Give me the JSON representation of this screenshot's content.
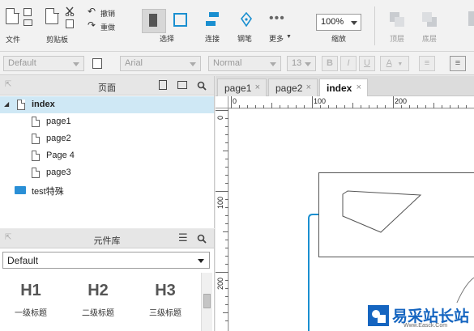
{
  "toolbar": {
    "file_label": "文件",
    "clipboard_label": "剪贴板",
    "undo_label": "撤销",
    "redo_label": "重做",
    "select_label": "选择",
    "connect_label": "连接",
    "pen_label": "钢笔",
    "more_label": "更多",
    "zoom_value": "100%",
    "zoom_label": "缩放",
    "top_label": "顶层",
    "bottom_label": "底层"
  },
  "formatbar": {
    "style_value": "Default",
    "font_value": "Arial",
    "weight_value": "Normal",
    "size_value": "13",
    "bold": "B",
    "italic": "I",
    "underline": "U",
    "text_color": "A"
  },
  "pages_panel": {
    "title": "页面",
    "items": [
      {
        "label": "index"
      },
      {
        "label": "page1"
      },
      {
        "label": "page2"
      },
      {
        "label": "Page 4"
      },
      {
        "label": "page3"
      },
      {
        "label": "test特殊"
      }
    ]
  },
  "library_panel": {
    "title": "元件库",
    "selected_library": "Default",
    "widgets": [
      {
        "big": "H1",
        "caption": "一级标题"
      },
      {
        "big": "H2",
        "caption": "二级标题"
      },
      {
        "big": "H3",
        "caption": "三级标题"
      }
    ]
  },
  "tabs": [
    {
      "label": "page1",
      "close": "×"
    },
    {
      "label": "page2",
      "close": "×"
    },
    {
      "label": "index",
      "close": "×"
    }
  ],
  "rulers": {
    "h_ticks": [
      "0",
      "100",
      "200"
    ],
    "v_ticks": [
      "0",
      "100",
      "200"
    ]
  },
  "watermark": {
    "text": "易采站长站",
    "sub": "Www.Easck.Com"
  },
  "colors": {
    "accent": "#1a8fd0",
    "selection": "#cfe8f5",
    "folder": "#2a8fd6",
    "watermark": "#1565c0"
  }
}
